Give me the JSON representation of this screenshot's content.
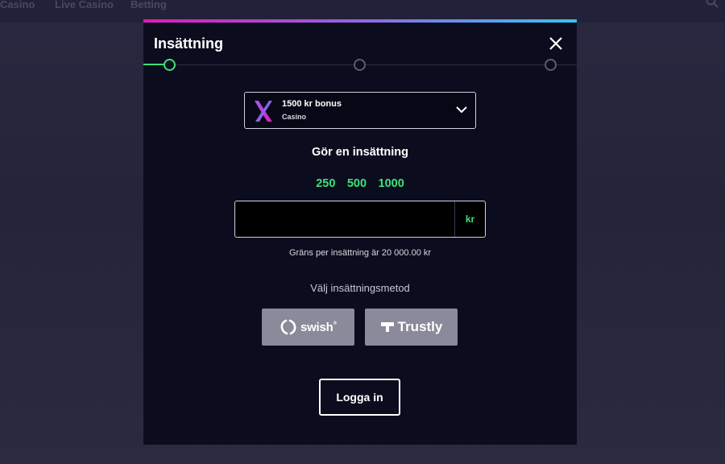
{
  "nav": {
    "items": [
      "Casino",
      "Live Casino",
      "Betting"
    ],
    "search_icon": "search-icon"
  },
  "modal": {
    "title": "Insättning",
    "close_icon": "close-icon",
    "stepper": {
      "steps": 3,
      "current": 1
    },
    "bonus": {
      "title": "1500 kr bonus",
      "subtitle": "Casino",
      "logo_icon": "x-brand-logo-icon"
    },
    "heading": "Gör en insättning",
    "quick_amounts": [
      "250",
      "500",
      "1000"
    ],
    "amount": {
      "value": "",
      "currency": "kr"
    },
    "limit_text": "Gräns per insättning är 20 000.00 kr",
    "method_label": "Välj insättningsmetod",
    "methods": {
      "swish": "swish",
      "swish_mark": "®",
      "trustly": "Trustly"
    },
    "login_label": "Logga in"
  },
  "colors": {
    "accent_green": "#3ee07a",
    "modal_bg": "#0b0d1e",
    "method_bg": "#8a8a9a",
    "gradient": [
      "#e01ab9",
      "#9a5de0",
      "#37c4ee"
    ]
  }
}
